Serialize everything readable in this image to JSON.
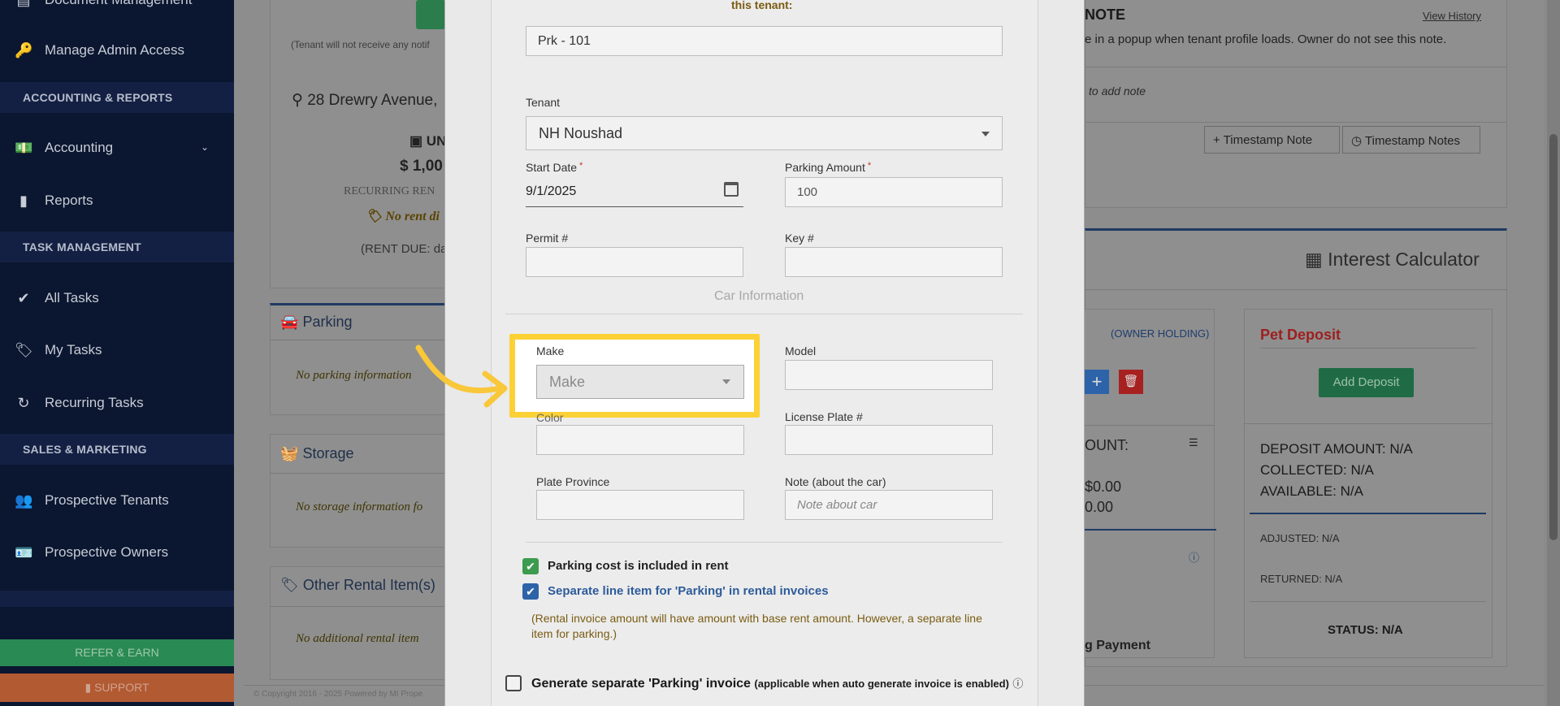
{
  "sidebar": {
    "top_item": "Document Management",
    "items": [
      {
        "label": "Manage Admin Access",
        "icon": "key-icon",
        "glyph": "🔑"
      },
      {
        "label": "Accounting",
        "icon": "money-icon",
        "glyph": "💵"
      },
      {
        "label": "Reports",
        "icon": "bar-chart-icon",
        "glyph": "▮"
      },
      {
        "label": "All Tasks",
        "icon": "check-icon",
        "glyph": "✔"
      },
      {
        "label": "My Tasks",
        "icon": "tag-icon",
        "glyph": "🏷"
      },
      {
        "label": "Recurring Tasks",
        "icon": "refresh-icon",
        "glyph": "↻"
      },
      {
        "label": "Prospective Tenants",
        "icon": "users-icon",
        "glyph": "👥"
      },
      {
        "label": "Prospective Owners",
        "icon": "id-card-icon",
        "glyph": "🪪"
      }
    ],
    "sections": {
      "accounting": "ACCOUNTING & REPORTS",
      "tasks": "TASK MANAGEMENT",
      "sales": "SALES & MARKETING"
    },
    "refer": "REFER & EARN",
    "support": "SUPPORT"
  },
  "background": {
    "tenant_notice": "(Tenant will not receive any notif",
    "address": "28 Drewry Avenue,",
    "unit": "UN",
    "rent": "$ 1,00",
    "recurring": "RECURRING REN",
    "no_rent": "No rent di",
    "rent_due": "(RENT DUE: da",
    "parking_title": "Parking",
    "parking_empty": "No parking information",
    "storage_title": "Storage",
    "storage_empty": "No storage information fo",
    "other_title": "Other Rental Item(s)",
    "other_empty": "No additional rental item",
    "copyright": "© Copyright 2016 - 2025 Powered by MI Prope",
    "note_title": "NOTE",
    "view_history": "View History",
    "note_desc": "e in a popup when tenant profile loads. Owner do not see this note.",
    "add_note": "to add note",
    "timestamp_note": "Timestamp Note",
    "timestamp_notes": "Timestamp Notes",
    "interest_calc": "Interest Calculator",
    "owner_holding": "(OWNER HOLDING)",
    "amount_label": "OUNT:",
    "amount1": "$0.00",
    "amount2": "0.00",
    "pay_link": "g Payment",
    "pet_deposit": "Pet Deposit",
    "add_deposit": "Add Deposit",
    "deposit_amount": "DEPOSIT AMOUNT: N/A",
    "collected": "COLLECTED: N/A",
    "available": "AVAILABLE: N/A",
    "adjusted": "ADJUSTED: N/A",
    "returned": "RETURNED: N/A",
    "status": "STATUS: N/A"
  },
  "modal": {
    "header_fragment": "this tenant:",
    "parking_id": "Prk - 101",
    "tenant_label": "Tenant",
    "tenant_value": "NH Noushad",
    "start_date_label": "Start Date",
    "start_date_value": "9/1/2025",
    "parking_amount_label": "Parking Amount",
    "parking_amount_value": "100",
    "permit_label": "Permit #",
    "key_label": "Key #",
    "car_info": "Car Information",
    "make_label": "Make",
    "make_placeholder": "Make",
    "model_label": "Model",
    "color_label": "Color",
    "license_label": "License Plate #",
    "province_label": "Plate Province",
    "note_label": "Note (about the car)",
    "note_placeholder": "Note about car",
    "chk_included": "Parking cost is included in rent",
    "chk_separate": "Separate line item for 'Parking' in rental invoices",
    "explain": "(Rental invoice amount will have amount with base rent amount. However, a separate line item for parking.)",
    "generate_label": "Generate separate 'Parking' invoice",
    "generate_hint": "(applicable when auto generate invoice is enabled)"
  },
  "colors": {
    "sidebar_bg": "#0b1630",
    "highlight": "#fbd135",
    "check_green": "#3c9b4e",
    "check_blue": "#2d63a8"
  }
}
